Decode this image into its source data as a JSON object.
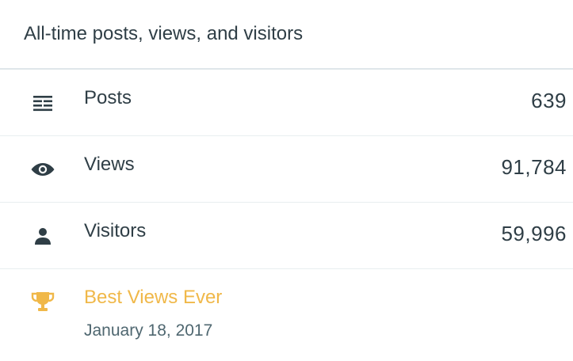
{
  "header": {
    "title": "All-time posts, views, and visitors"
  },
  "stats": [
    {
      "label": "Posts",
      "value": "639",
      "icon": "posts-list-icon"
    },
    {
      "label": "Views",
      "value": "91,784",
      "icon": "eye-icon"
    },
    {
      "label": "Visitors",
      "value": "59,996",
      "icon": "person-icon"
    }
  ],
  "best": {
    "title": "Best Views Ever",
    "date": "January 18, 2017",
    "icon": "trophy-icon",
    "accent_color": "#f0b849"
  },
  "colors": {
    "text": "#2f3e46",
    "muted": "#4f6770",
    "divider": "#e8eef0"
  }
}
